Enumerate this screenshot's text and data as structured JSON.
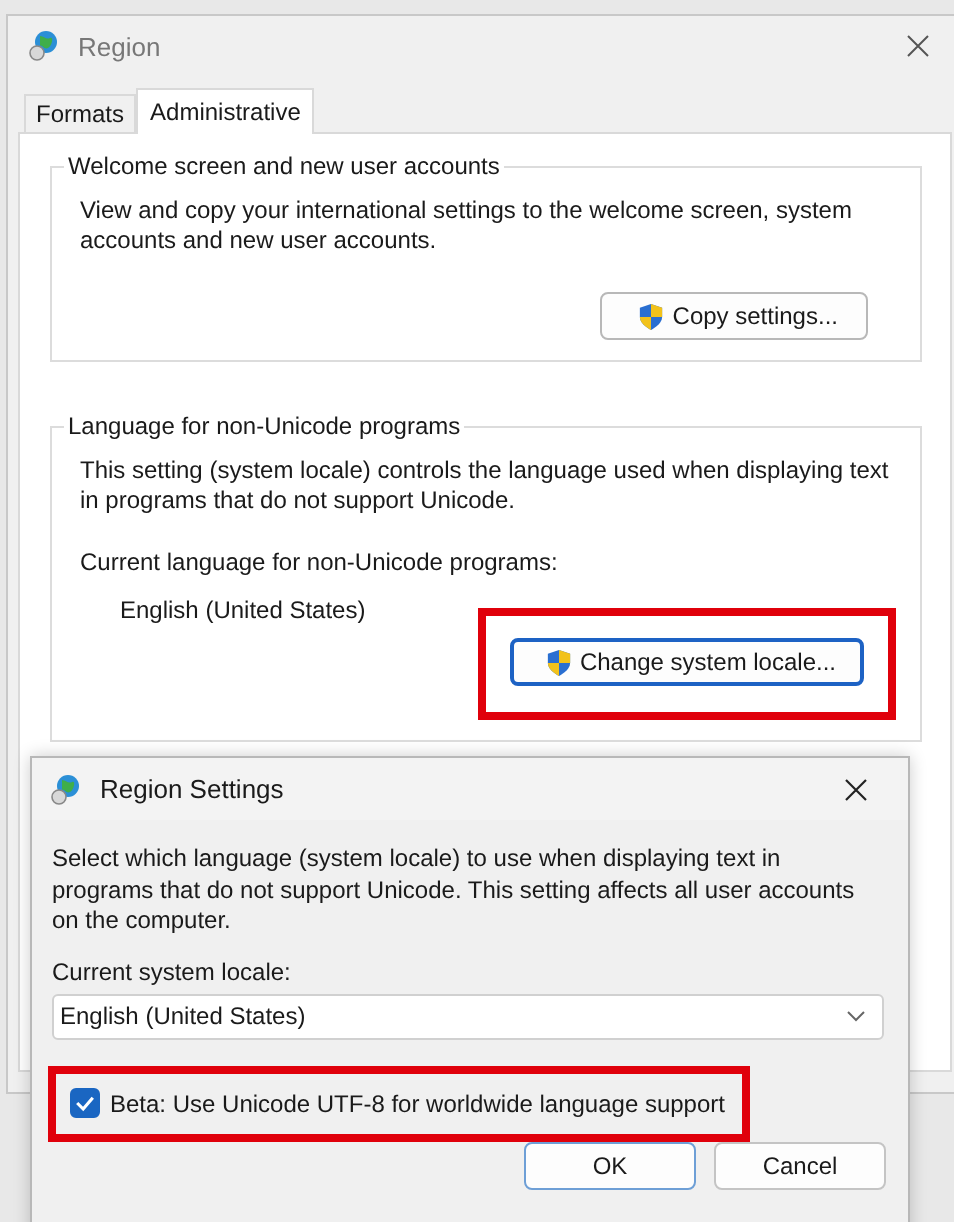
{
  "window": {
    "title": "Region"
  },
  "tabs": [
    {
      "label": "Formats",
      "selected": false
    },
    {
      "label": "Administrative",
      "selected": true
    }
  ],
  "groups": [
    {
      "title": "Welcome screen and new user accounts",
      "description": "View and copy your international settings to the welcome screen, system accounts and new user accounts.",
      "button": {
        "label": "Copy settings...",
        "highlighted": false
      }
    },
    {
      "title": "Language for non-Unicode programs",
      "description": "This setting (system locale) controls the language used when displaying text in programs that do not support Unicode.",
      "current_label": "Current language for non-Unicode programs:",
      "current_value": "English (United States)",
      "button": {
        "label": "Change system locale...",
        "highlighted": true
      }
    }
  ],
  "dialog": {
    "title": "Region Settings",
    "description": "Select which language (system locale) to use when displaying text in programs that do not support Unicode. This setting affects all user accounts on the computer.",
    "locale_label": "Current system locale:",
    "locale_value": "English (United States)",
    "checkbox": {
      "label": "Beta: Use Unicode UTF-8 for worldwide language support",
      "checked": true,
      "highlighted": true
    },
    "buttons": [
      {
        "label": "OK",
        "kind": "default"
      },
      {
        "label": "Cancel",
        "kind": "normal"
      }
    ]
  }
}
